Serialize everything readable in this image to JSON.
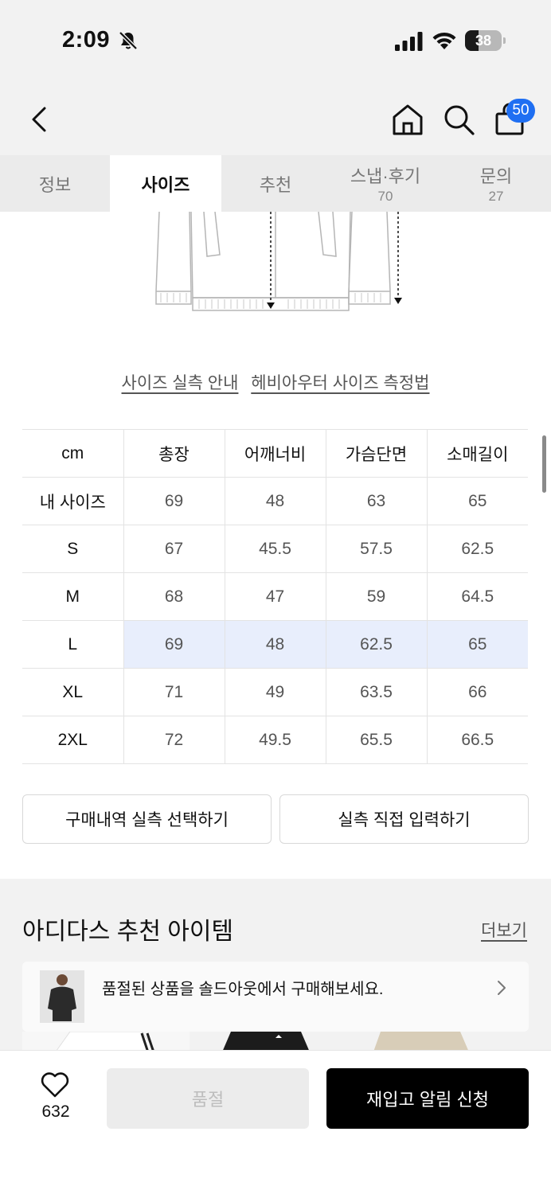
{
  "status_bar": {
    "time": "2:09",
    "battery_level": "38",
    "battery_fraction": 0.38,
    "icons": [
      "bell-slash-icon",
      "signal-icon",
      "wifi-icon",
      "battery-icon"
    ]
  },
  "header": {
    "icons": [
      "back-chevron-icon",
      "home-icon",
      "search-icon",
      "shopping-bag-icon"
    ],
    "cart_count": "50",
    "badge_color": "#1f6ff2"
  },
  "tabs": [
    {
      "label": "정보",
      "count": ""
    },
    {
      "label": "사이즈",
      "count": ""
    },
    {
      "label": "추천",
      "count": ""
    },
    {
      "label": "스냅·후기",
      "count": "70"
    },
    {
      "label": "문의",
      "count": "27"
    }
  ],
  "size_links": {
    "guide": "사이즈 실측 안내",
    "measure": "헤비아우터 사이즈 측정법"
  },
  "size_table": {
    "unit": "cm",
    "columns": [
      "총장",
      "어깨너비",
      "가슴단면",
      "소매길이"
    ],
    "rows": [
      {
        "label": "내 사이즈",
        "values": [
          "69",
          "48",
          "63",
          "65"
        ]
      },
      {
        "label": "S",
        "values": [
          "67",
          "45.5",
          "57.5",
          "62.5"
        ]
      },
      {
        "label": "M",
        "values": [
          "68",
          "47",
          "59",
          "64.5"
        ]
      },
      {
        "label": "L",
        "values": [
          "69",
          "48",
          "62.5",
          "65"
        ]
      },
      {
        "label": "XL",
        "values": [
          "71",
          "49",
          "63.5",
          "66"
        ]
      },
      {
        "label": "2XL",
        "values": [
          "72",
          "49.5",
          "65.5",
          "66.5"
        ]
      }
    ],
    "highlight_row": "L",
    "highlight_color": "#e8eefc"
  },
  "actions": {
    "purchase_history": "구매내역 실측 선택하기",
    "manual_input": "실측 직접 입력하기"
  },
  "recommend": {
    "title": "아디다스 추천 아이템",
    "more": "더보기",
    "banner_text": "품절된 상품을 솔드아웃에서 구매해보세요."
  },
  "bottom_bar": {
    "like_count": "632",
    "soldout_label": "품절",
    "restock_label": "재입고 알림 신청"
  }
}
